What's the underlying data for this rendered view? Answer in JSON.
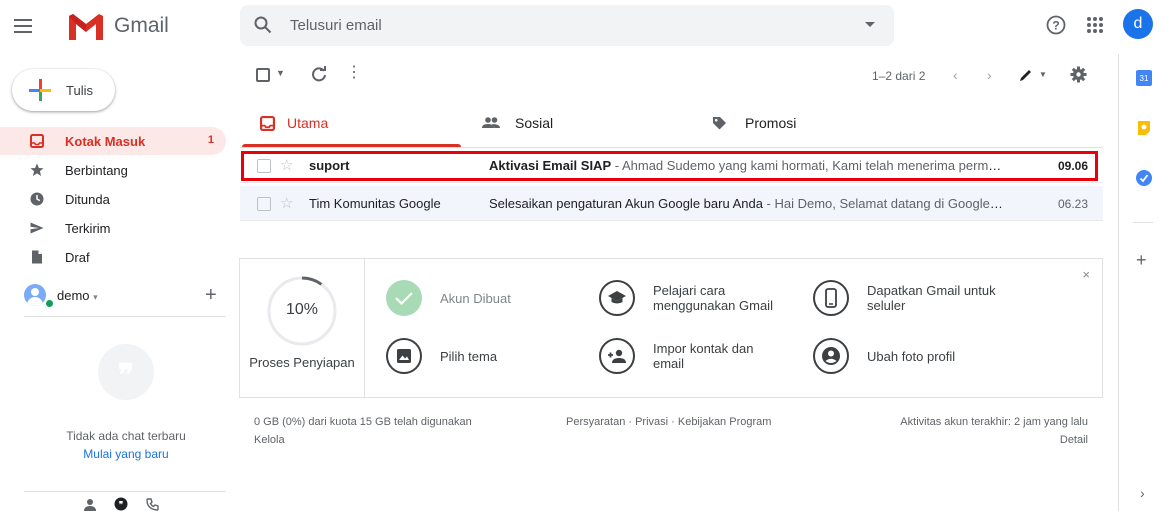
{
  "header": {
    "brand": "Gmail",
    "search_placeholder": "Telusuri email",
    "avatar_letter": "d"
  },
  "compose": {
    "label": "Tulis"
  },
  "sidebar": {
    "items": [
      {
        "label": "Kotak Masuk",
        "count": "1",
        "icon": "inbox-icon"
      },
      {
        "label": "Berbintang",
        "icon": "star-icon"
      },
      {
        "label": "Ditunda",
        "icon": "clock-icon"
      },
      {
        "label": "Terkirim",
        "icon": "send-icon"
      },
      {
        "label": "Draf",
        "icon": "draft-icon"
      }
    ]
  },
  "hangouts": {
    "user": "demo",
    "no_chat": "Tidak ada chat terbaru",
    "start_chat": "Mulai yang baru"
  },
  "toolbar": {
    "pages": "1–2 dari 2"
  },
  "tabs": [
    {
      "label": "Utama",
      "icon": "inbox-icon"
    },
    {
      "label": "Sosial",
      "icon": "people-icon"
    },
    {
      "label": "Promosi",
      "icon": "tag-icon"
    }
  ],
  "emails": [
    {
      "from": "suport",
      "subject": "Aktivasi Email SIAP",
      "snippet": " - Ahmad Sudemo yang kami hormati, Kami telah menerima permin…",
      "date": "09.06",
      "unread": true
    },
    {
      "from": "Tim Komunitas Google",
      "subject": "Selesaikan pengaturan Akun Google baru Anda",
      "snippet": " - Hai Demo, Selamat datang di Google. …",
      "date": "06.23",
      "unread": false
    }
  ],
  "setup": {
    "progress_text": "10%",
    "progress": 0.1,
    "progress_label": "Proses Penyiapan",
    "items": [
      {
        "label": "Akun Dibuat",
        "icon": "check-icon"
      },
      {
        "label": "Pelajari cara menggunakan Gmail",
        "icon": "graduation-cap-icon"
      },
      {
        "label": "Dapatkan Gmail untuk seluler",
        "icon": "phone-icon"
      },
      {
        "label": "Pilih tema",
        "icon": "image-icon"
      },
      {
        "label": "Impor kontak dan email",
        "icon": "add-contact-icon"
      },
      {
        "label": "Ubah foto profil",
        "icon": "account-circle-icon"
      }
    ],
    "close": "×"
  },
  "footer": {
    "quota": "0 GB (0%) dari kuota 15 GB telah digunakan",
    "manage": "Kelola",
    "links": "Persyaratan · Privasi · Kebijakan Program",
    "activity": "Aktivitas akun terakhir: 2 jam yang lalu",
    "details": "Detail"
  },
  "rail": {
    "calendar_day": "31"
  },
  "colors": {
    "accent": "#d93025",
    "blue": "#1a73e8",
    "highlight": "#e8000b"
  }
}
